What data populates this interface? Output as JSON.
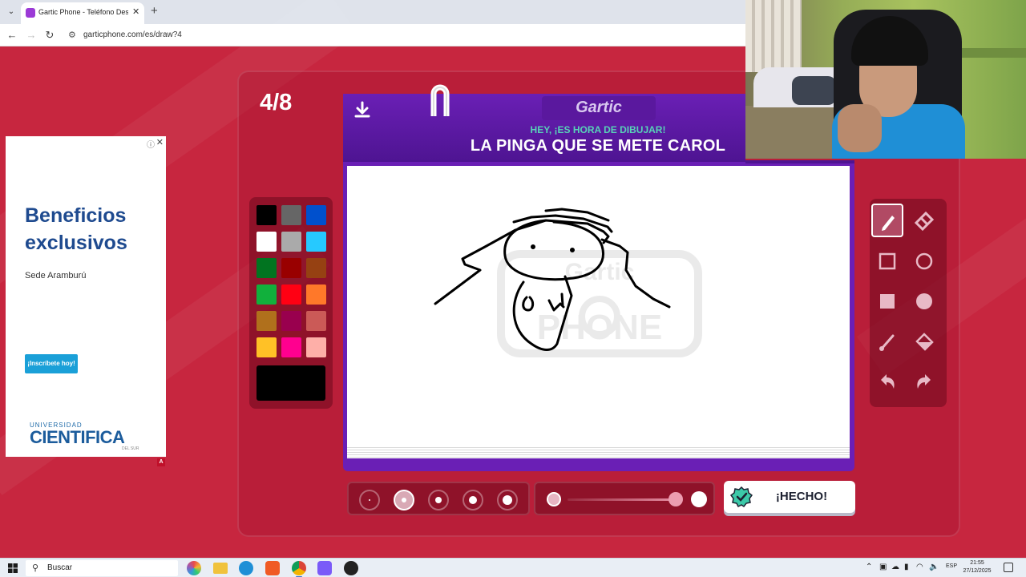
{
  "browser": {
    "tab_title": "Gartic Phone - Teléfono Descon",
    "url": "garticphone.com/es/draw?4"
  },
  "ad": {
    "headline": "Beneficios exclusivos",
    "sub": "Sede Aramburú",
    "cta": "¡Inscríbete hoy!",
    "logo_top": "UNIVERSIDAD",
    "logo": "CIENTIFICA",
    "logo_bottom": "DEL SUR",
    "badge": "A"
  },
  "game": {
    "round": "4/8",
    "logo": "Gartic",
    "prompt_sub": "HEY, ¡ES HORA DE DIBUJAR!",
    "prompt_main": "LA PINGA QUE SE METE CAROL",
    "watermark_line1": "Gartic",
    "watermark_line2": "PHONE",
    "done_label": "¡HECHO!",
    "palette": [
      "#000000",
      "#666666",
      "#0050cd",
      "#ffffff",
      "#aaaaaa",
      "#26c9ff",
      "#017420",
      "#990000",
      "#964112",
      "#11b03c",
      "#ff0013",
      "#ff7829",
      "#b0701c",
      "#99004e",
      "#cb5a57",
      "#ffc126",
      "#ff008f",
      "#feafa8"
    ],
    "selected_color": "#000000",
    "tools": [
      "pencil-icon",
      "eraser-icon",
      "rectangle-outline-icon",
      "circle-outline-icon",
      "rectangle-filled-icon",
      "circle-filled-icon",
      "line-icon",
      "fill-bucket-icon",
      "undo-icon",
      "redo-icon"
    ],
    "active_tool": "pencil-icon",
    "brush_sizes": 5,
    "active_brush_size": 2
  },
  "taskbar": {
    "search": "Buscar",
    "lang": "ESP",
    "time": "21:55",
    "date": "27/12/2025"
  }
}
